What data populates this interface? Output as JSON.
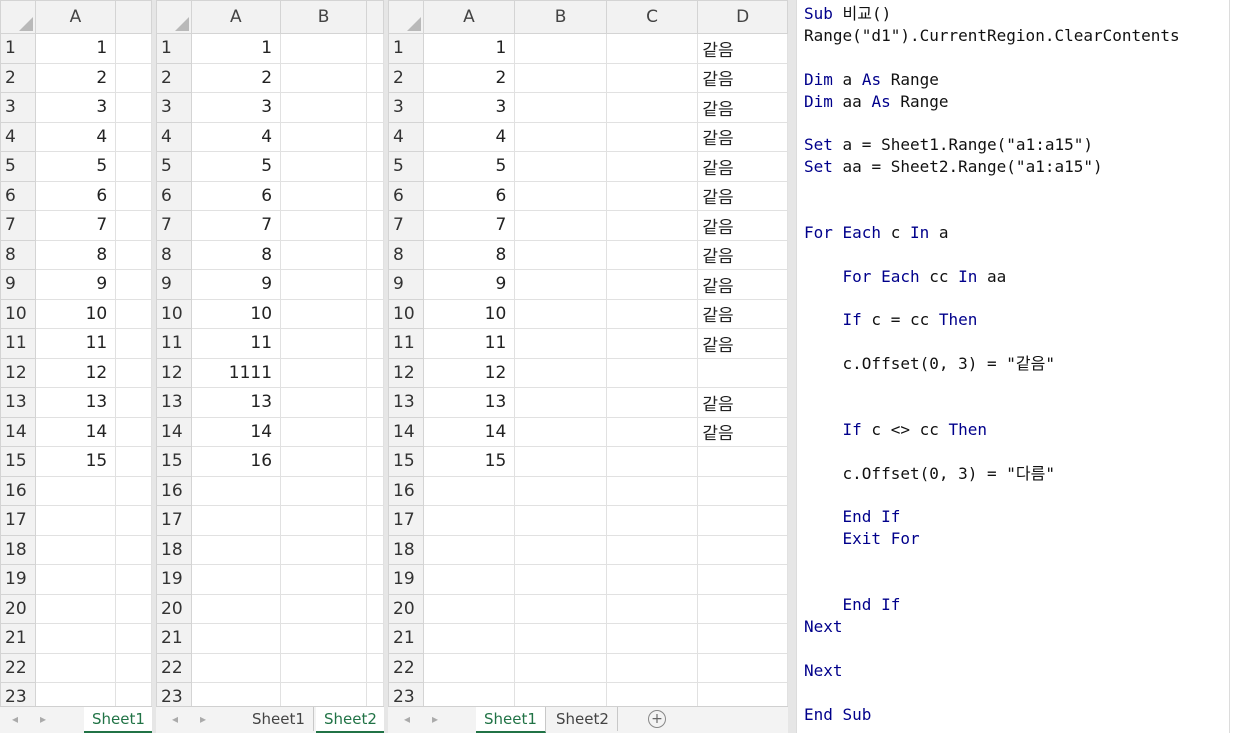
{
  "panel1": {
    "columns": [
      "A"
    ],
    "rows": [
      {
        "n": "1",
        "a": "1"
      },
      {
        "n": "2",
        "a": "2"
      },
      {
        "n": "3",
        "a": "3"
      },
      {
        "n": "4",
        "a": "4"
      },
      {
        "n": "5",
        "a": "5"
      },
      {
        "n": "6",
        "a": "6"
      },
      {
        "n": "7",
        "a": "7"
      },
      {
        "n": "8",
        "a": "8"
      },
      {
        "n": "9",
        "a": "9"
      },
      {
        "n": "10",
        "a": "10"
      },
      {
        "n": "11",
        "a": "11"
      },
      {
        "n": "12",
        "a": "12"
      },
      {
        "n": "13",
        "a": "13"
      },
      {
        "n": "14",
        "a": "14"
      },
      {
        "n": "15",
        "a": "15"
      },
      {
        "n": "16",
        "a": ""
      },
      {
        "n": "17",
        "a": ""
      },
      {
        "n": "18",
        "a": ""
      },
      {
        "n": "19",
        "a": ""
      },
      {
        "n": "20",
        "a": ""
      },
      {
        "n": "21",
        "a": ""
      },
      {
        "n": "22",
        "a": ""
      },
      {
        "n": "23",
        "a": ""
      }
    ],
    "tabs": [
      "Sheet1"
    ],
    "active_tab": "Sheet1"
  },
  "panel2": {
    "columns": [
      "A",
      "B"
    ],
    "rows": [
      {
        "n": "1",
        "a": "1"
      },
      {
        "n": "2",
        "a": "2"
      },
      {
        "n": "3",
        "a": "3"
      },
      {
        "n": "4",
        "a": "4"
      },
      {
        "n": "5",
        "a": "5"
      },
      {
        "n": "6",
        "a": "6"
      },
      {
        "n": "7",
        "a": "7"
      },
      {
        "n": "8",
        "a": "8"
      },
      {
        "n": "9",
        "a": "9"
      },
      {
        "n": "10",
        "a": "10"
      },
      {
        "n": "11",
        "a": "11"
      },
      {
        "n": "12",
        "a": "1111"
      },
      {
        "n": "13",
        "a": "13"
      },
      {
        "n": "14",
        "a": "14"
      },
      {
        "n": "15",
        "a": "16"
      },
      {
        "n": "16",
        "a": ""
      },
      {
        "n": "17",
        "a": ""
      },
      {
        "n": "18",
        "a": ""
      },
      {
        "n": "19",
        "a": ""
      },
      {
        "n": "20",
        "a": ""
      },
      {
        "n": "21",
        "a": ""
      },
      {
        "n": "22",
        "a": ""
      },
      {
        "n": "23",
        "a": ""
      }
    ],
    "tabs": [
      "Sheet1",
      "Sheet2"
    ],
    "active_tab": "Sheet2"
  },
  "panel3": {
    "columns": [
      "A",
      "B",
      "C",
      "D"
    ],
    "rows": [
      {
        "n": "1",
        "a": "1",
        "d": "같음"
      },
      {
        "n": "2",
        "a": "2",
        "d": "같음"
      },
      {
        "n": "3",
        "a": "3",
        "d": "같음"
      },
      {
        "n": "4",
        "a": "4",
        "d": "같음"
      },
      {
        "n": "5",
        "a": "5",
        "d": "같음"
      },
      {
        "n": "6",
        "a": "6",
        "d": "같음"
      },
      {
        "n": "7",
        "a": "7",
        "d": "같음"
      },
      {
        "n": "8",
        "a": "8",
        "d": "같음"
      },
      {
        "n": "9",
        "a": "9",
        "d": "같음"
      },
      {
        "n": "10",
        "a": "10",
        "d": "같음"
      },
      {
        "n": "11",
        "a": "11",
        "d": "같음"
      },
      {
        "n": "12",
        "a": "12",
        "d": ""
      },
      {
        "n": "13",
        "a": "13",
        "d": "같음"
      },
      {
        "n": "14",
        "a": "14",
        "d": "같음"
      },
      {
        "n": "15",
        "a": "15",
        "d": ""
      },
      {
        "n": "16",
        "a": "",
        "d": ""
      },
      {
        "n": "17",
        "a": "",
        "d": ""
      },
      {
        "n": "18",
        "a": "",
        "d": ""
      },
      {
        "n": "19",
        "a": "",
        "d": ""
      },
      {
        "n": "20",
        "a": "",
        "d": ""
      },
      {
        "n": "21",
        "a": "",
        "d": ""
      },
      {
        "n": "22",
        "a": "",
        "d": ""
      },
      {
        "n": "23",
        "a": "",
        "d": ""
      }
    ],
    "tabs": [
      "Sheet1",
      "Sheet2"
    ],
    "active_tab": "Sheet1",
    "add_sheet_symbol": "+"
  },
  "nav_prev": "◂",
  "nav_next": "▸",
  "code_lines": [
    [
      {
        "t": "Sub",
        "k": true
      },
      {
        "t": " 비교()"
      }
    ],
    [
      {
        "t": "Range(\"d1\").CurrentRegion.ClearContents"
      }
    ],
    [
      {
        "t": ""
      }
    ],
    [
      {
        "t": "Dim",
        "k": true
      },
      {
        "t": " a "
      },
      {
        "t": "As",
        "k": true
      },
      {
        "t": " Range"
      }
    ],
    [
      {
        "t": "Dim",
        "k": true
      },
      {
        "t": " aa "
      },
      {
        "t": "As",
        "k": true
      },
      {
        "t": " Range"
      }
    ],
    [
      {
        "t": ""
      }
    ],
    [
      {
        "t": "Set",
        "k": true
      },
      {
        "t": " a = Sheet1.Range(\"a1:a15\")"
      }
    ],
    [
      {
        "t": "Set",
        "k": true
      },
      {
        "t": " aa = Sheet2.Range(\"a1:a15\")"
      }
    ],
    [
      {
        "t": ""
      }
    ],
    [
      {
        "t": ""
      }
    ],
    [
      {
        "t": "For Each",
        "k": true
      },
      {
        "t": " c "
      },
      {
        "t": "In",
        "k": true
      },
      {
        "t": " a"
      }
    ],
    [
      {
        "t": ""
      }
    ],
    [
      {
        "t": "    "
      },
      {
        "t": "For Each",
        "k": true
      },
      {
        "t": " cc "
      },
      {
        "t": "In",
        "k": true
      },
      {
        "t": " aa"
      }
    ],
    [
      {
        "t": ""
      }
    ],
    [
      {
        "t": "    "
      },
      {
        "t": "If",
        "k": true
      },
      {
        "t": " c = cc "
      },
      {
        "t": "Then",
        "k": true
      }
    ],
    [
      {
        "t": ""
      }
    ],
    [
      {
        "t": "    c.Offset(0, 3) = \"같음\""
      }
    ],
    [
      {
        "t": ""
      }
    ],
    [
      {
        "t": ""
      }
    ],
    [
      {
        "t": "    "
      },
      {
        "t": "If",
        "k": true
      },
      {
        "t": " c <> cc "
      },
      {
        "t": "Then",
        "k": true
      }
    ],
    [
      {
        "t": ""
      }
    ],
    [
      {
        "t": "    c.Offset(0, 3) = \"다름\""
      }
    ],
    [
      {
        "t": ""
      }
    ],
    [
      {
        "t": "    "
      },
      {
        "t": "End If",
        "k": true
      }
    ],
    [
      {
        "t": "    "
      },
      {
        "t": "Exit For",
        "k": true
      }
    ],
    [
      {
        "t": ""
      }
    ],
    [
      {
        "t": ""
      }
    ],
    [
      {
        "t": "    "
      },
      {
        "t": "End If",
        "k": true
      }
    ],
    [
      {
        "t": "Next",
        "k": true
      }
    ],
    [
      {
        "t": ""
      }
    ],
    [
      {
        "t": "Next",
        "k": true
      }
    ],
    [
      {
        "t": ""
      }
    ],
    [
      {
        "t": "End Sub",
        "k": true
      }
    ]
  ]
}
